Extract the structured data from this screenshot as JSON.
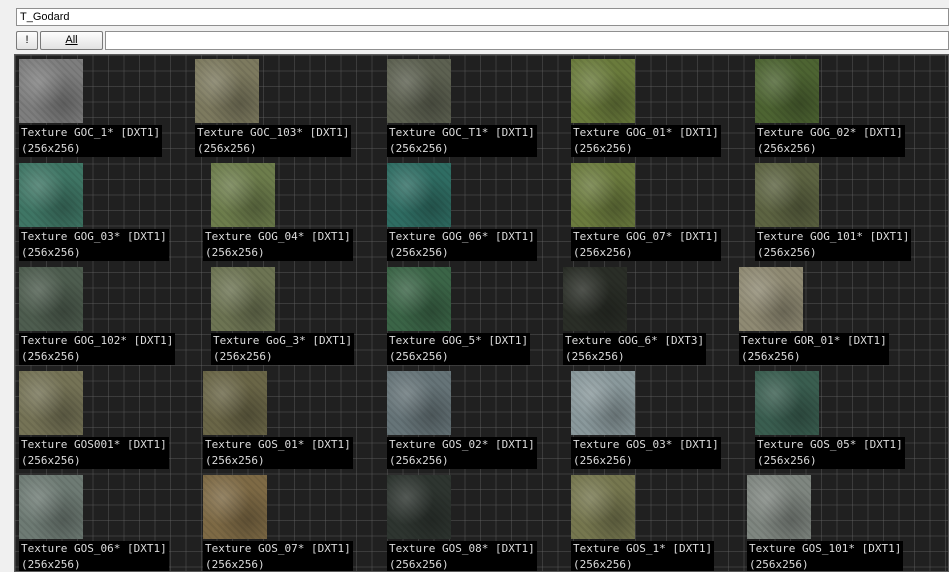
{
  "toolbar": {
    "package_value": "T_Godard",
    "exclaim_label": "!",
    "all_label": "All",
    "filter_value": ""
  },
  "textures": [
    {
      "name": "Texture GOC_1* [DXT1]",
      "size": "(256x256)",
      "color": "#7e7e7e"
    },
    {
      "name": "Texture GOC_103* [DXT1]",
      "size": "(256x256)",
      "color": "#7d7a5f"
    },
    {
      "name": "Texture GOC_T1* [DXT1]",
      "size": "(256x256)",
      "color": "#5d6151"
    },
    {
      "name": "Texture GOG_01* [DXT1]",
      "size": "(256x256)",
      "color": "#6a7b3c"
    },
    {
      "name": "Texture GOG_02* [DXT1]",
      "size": "(256x256)",
      "color": "#4d6432"
    },
    {
      "name": "Texture GOG_03* [DXT1]",
      "size": "(256x256)",
      "color": "#3f7665"
    },
    {
      "name": "Texture GOG_04* [DXT1]",
      "size": "(256x256)",
      "color": "#6d7d4c"
    },
    {
      "name": "Texture GOG_06* [DXT1]",
      "size": "(256x256)",
      "color": "#2f6d63"
    },
    {
      "name": "Texture GOG_07* [DXT1]",
      "size": "(256x256)",
      "color": "#6b7b3e"
    },
    {
      "name": "Texture GOG_101* [DXT1]",
      "size": "(256x256)",
      "color": "#5d6442"
    },
    {
      "name": "Texture GOG_102* [DXT1]",
      "size": "(256x256)",
      "color": "#4e5d4f"
    },
    {
      "name": "Texture GoG_3* [DXT1]",
      "size": "(256x256)",
      "color": "#6d7453"
    },
    {
      "name": "Texture GOG_5* [DXT1]",
      "size": "(256x256)",
      "color": "#3b6547"
    },
    {
      "name": "Texture GOG_6* [DXT3]",
      "size": "(256x256)",
      "color": "#2a2e27"
    },
    {
      "name": "Texture GOR_01* [DXT1]",
      "size": "(256x256)",
      "color": "#8f8a73"
    },
    {
      "name": "Texture GOS001* [DXT1]",
      "size": "(256x256)",
      "color": "#757356"
    },
    {
      "name": "Texture GOS_01* [DXT1]",
      "size": "(256x256)",
      "color": "#6a6647"
    },
    {
      "name": "Texture GOS_02* [DXT1]",
      "size": "(256x256)",
      "color": "#667478"
    },
    {
      "name": "Texture GOS_03* [DXT1]",
      "size": "(256x256)",
      "color": "#8a999c"
    },
    {
      "name": "Texture GOS_05* [DXT1]",
      "size": "(256x256)",
      "color": "#3a5e50"
    },
    {
      "name": "Texture GOS_06* [DXT1]",
      "size": "(256x256)",
      "color": "#6e7b74"
    },
    {
      "name": "Texture GOS_07* [DXT1]",
      "size": "(256x256)",
      "color": "#7e6a45"
    },
    {
      "name": "Texture GOS_08* [DXT1]",
      "size": "(256x256)",
      "color": "#2e3530"
    },
    {
      "name": "Texture GOS_1* [DXT1]",
      "size": "(256x256)",
      "color": "#76774f"
    },
    {
      "name": "Texture GOS_101* [DXT1]",
      "size": "(256x256)",
      "color": "#7f8680"
    }
  ]
}
